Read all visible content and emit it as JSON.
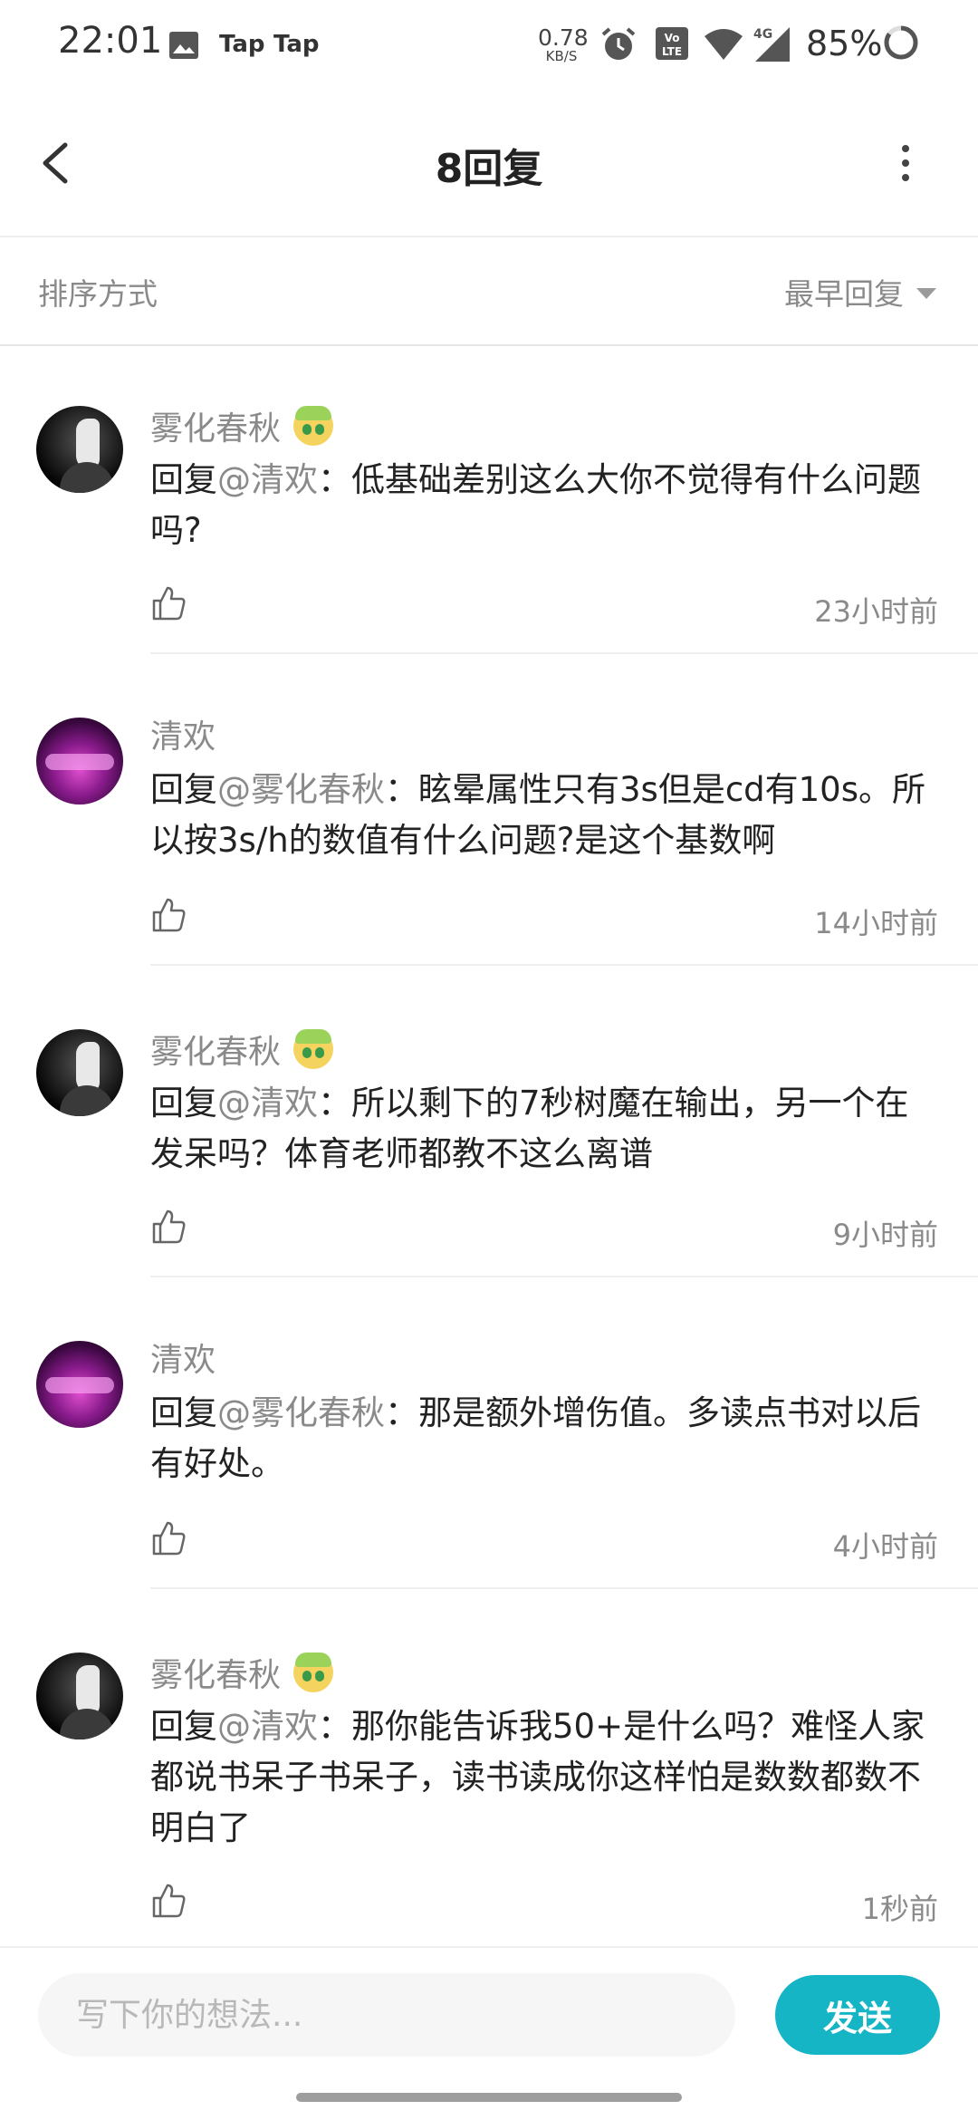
{
  "status_bar": {
    "time": "22:01",
    "tap1": "Tap",
    "tap2": "Tap",
    "net_speed": "0.78",
    "net_unit": "KB/S",
    "volte": "Vo LTE",
    "signal_type": "4G",
    "battery": "85%"
  },
  "header": {
    "title": "8回复"
  },
  "sort": {
    "label": "排序方式",
    "selected": "最早回复"
  },
  "replies": [
    {
      "author": "雾化春秋",
      "has_badge": true,
      "reply_prefix": "回复",
      "mention": "@清欢",
      "content": "：低基础差别这么大你不觉得有什么问题吗?",
      "time": "23小时前"
    },
    {
      "author": "清欢",
      "has_badge": false,
      "reply_prefix": "回复",
      "mention": "@雾化春秋",
      "content": "：眩晕属性只有3s但是cd有10s。所以按3s/h的数值有什么问题?是这个基数啊",
      "time": "14小时前"
    },
    {
      "author": "雾化春秋",
      "has_badge": true,
      "reply_prefix": "回复",
      "mention": "@清欢",
      "content": "：所以剩下的7秒树魔在输出，另一个在发呆吗？体育老师都教不这么离谱",
      "time": "9小时前"
    },
    {
      "author": "清欢",
      "has_badge": false,
      "reply_prefix": "回复",
      "mention": "@雾化春秋",
      "content": "：那是额外增伤值。多读点书对以后有好处。",
      "time": "4小时前"
    },
    {
      "author": "雾化春秋",
      "has_badge": true,
      "reply_prefix": "回复",
      "mention": "@清欢",
      "content": "：那你能告诉我50+是什么吗？难怪人家都说书呆子书呆子，读书读成你这样怕是数数都数不明白了",
      "time": "1秒前"
    }
  ],
  "composer": {
    "placeholder": "写下你的想法...",
    "send_label": "发送"
  },
  "colors": {
    "accent": "#15b5c6",
    "muted_text": "#8a8a8a"
  },
  "icons": {
    "back": "back-arrow-icon",
    "more": "more-vertical-icon",
    "like": "thumbs-up-icon"
  }
}
